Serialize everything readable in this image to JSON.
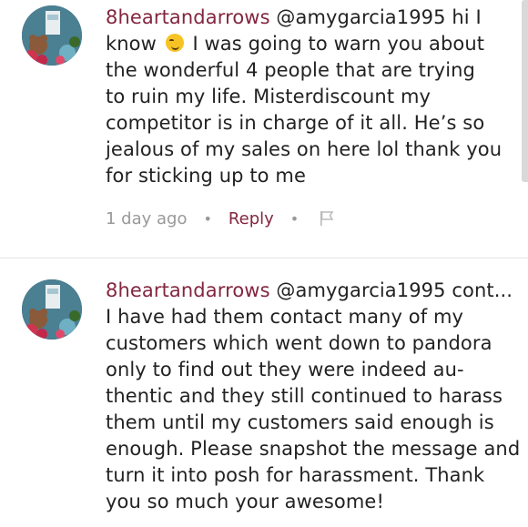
{
  "comments": [
    {
      "username": "8heartandarrows",
      "lines": [
        "@amygarcia1995 hi I",
        "know",
        " I was going to warn you about",
        "the wonderful 4 people that are trying",
        "to ruin my life. Misterdiscount my",
        "competitor is in charge of it all. He’s so",
        "jealous of my sales on here lol thank you",
        "for sticking up to me"
      ],
      "timestamp": "1 day ago",
      "reply_label": "Reply",
      "emoji": "winking-face"
    },
    {
      "username": "8heartandarrows",
      "lines": [
        "@amygarcia1995 cont...",
        "I have had them contact many of my",
        "customers which went down to pandora",
        "only to find out they were indeed au-",
        "thentic and they still continued to harass",
        "them until my customers said  enough is",
        "enough. Please snapshot the message and",
        "turn it into posh for harassment. Thank",
        "you so much your awesome!"
      ]
    }
  ],
  "colors": {
    "username": "#83263f",
    "text": "#222222",
    "meta": "#999999",
    "reply": "#83263f"
  }
}
